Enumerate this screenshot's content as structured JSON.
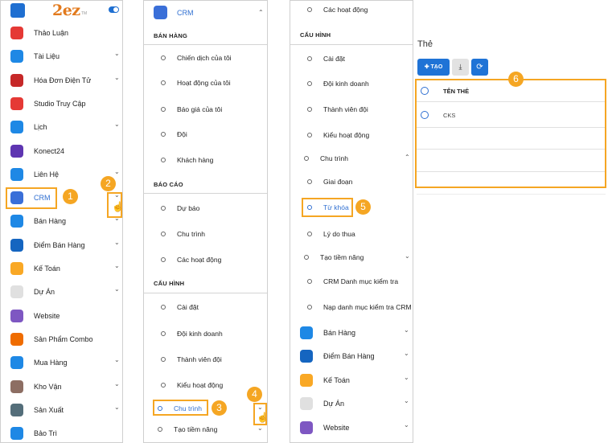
{
  "sidebar": {
    "brand": "2ez",
    "brand_tm": "TM",
    "items": [
      {
        "label": "Thảo Luận",
        "icon": "chat-icon",
        "color": "#e53935",
        "chevron": false
      },
      {
        "label": "Tài Liệu",
        "icon": "folder-icon",
        "color": "#1e88e5",
        "chevron": true
      },
      {
        "label": "Hóa Đơn Điện Tử",
        "icon": "invoice-icon",
        "color": "#c62828",
        "chevron": true
      },
      {
        "label": "Studio Truy Cập",
        "icon": "users-icon",
        "color": "#e53935",
        "chevron": false
      },
      {
        "label": "Lịch",
        "icon": "calendar-icon",
        "color": "#1e88e5",
        "chevron": true
      },
      {
        "label": "Konect24",
        "icon": "konect-icon",
        "color": "#5e35b1",
        "chevron": false
      },
      {
        "label": "Liên Hệ",
        "icon": "contact-icon",
        "color": "#1e88e5",
        "chevron": true
      },
      {
        "label": "CRM",
        "icon": "handshake-icon",
        "color": "#3a6fd8",
        "chevron": true
      },
      {
        "label": "Bán Hàng",
        "icon": "sales-chart-icon",
        "color": "#1e88e5",
        "chevron": true
      },
      {
        "label": "Điểm Bán Hàng",
        "icon": "store-icon",
        "color": "#1565c0",
        "chevron": true
      },
      {
        "label": "Kế Toán",
        "icon": "accounting-icon",
        "color": "#f9a825",
        "chevron": true
      },
      {
        "label": "Dự Án",
        "icon": "project-icon",
        "color": "#e0e0e0",
        "chevron": true
      },
      {
        "label": "Website",
        "icon": "website-icon",
        "color": "#7e57c2",
        "chevron": false
      },
      {
        "label": "Sản Phẩm Combo",
        "icon": "combo-icon",
        "color": "#ef6c00",
        "chevron": false
      },
      {
        "label": "Mua Hàng",
        "icon": "purchase-icon",
        "color": "#1e88e5",
        "chevron": true
      },
      {
        "label": "Kho Vận",
        "icon": "warehouse-icon",
        "color": "#8d6e63",
        "chevron": true
      },
      {
        "label": "Sản Xuất",
        "icon": "wrench-icon",
        "color": "#546e7a",
        "chevron": true
      },
      {
        "label": "Bảo Trì",
        "icon": "maintenance-icon",
        "color": "#1e88e5",
        "chevron": false
      }
    ]
  },
  "crm_menu": {
    "title": "CRM",
    "sections": [
      {
        "title": "BÁN HÀNG",
        "items": [
          "Chiến dịch của tôi",
          "Hoạt động của tôi",
          "Báo giá của tôi",
          "Đội",
          "Khách hàng"
        ]
      },
      {
        "title": "BÁO CÁO",
        "items": [
          "Dự báo",
          "Chu trình",
          "Các hoạt động"
        ]
      },
      {
        "title": "CẤU HÌNH",
        "items": [
          "Cài đặt",
          "Đội kinh doanh",
          "Thành viên đội",
          "Kiểu hoạt động",
          "Chu trình",
          "Tạo tiềm năng"
        ]
      }
    ]
  },
  "crm_menu_expanded": {
    "top_item": "Các hoạt động",
    "section_title": "CẤU HÌNH",
    "items": [
      "Cài đặt",
      "Đội kinh doanh",
      "Thành viên đội",
      "Kiểu hoạt động"
    ],
    "group": "Chu trình",
    "group_items": [
      "Giai đoạn",
      "Từ khóa",
      "Lý do thua"
    ],
    "group2": "Tạo tiềm năng",
    "group2_items": [
      "CRM Danh mục kiểm tra",
      "Nạp danh mục kiểm tra CRM"
    ],
    "apps": [
      "Bán Hàng",
      "Điểm Bán Hàng",
      "Kế Toán",
      "Dự Án",
      "Website"
    ]
  },
  "tags_page": {
    "title": "Thẻ",
    "create_label": "TẠO",
    "download_icon": "download-icon",
    "refresh_icon": "refresh-icon",
    "column_header": "TÊN THẺ",
    "rows": [
      "CKS"
    ]
  },
  "callouts": [
    "1",
    "2",
    "3",
    "4",
    "5",
    "6"
  ],
  "colors": {
    "accent": "#2f6fd1",
    "callout": "#f5a623",
    "button": "#1f73d6"
  }
}
